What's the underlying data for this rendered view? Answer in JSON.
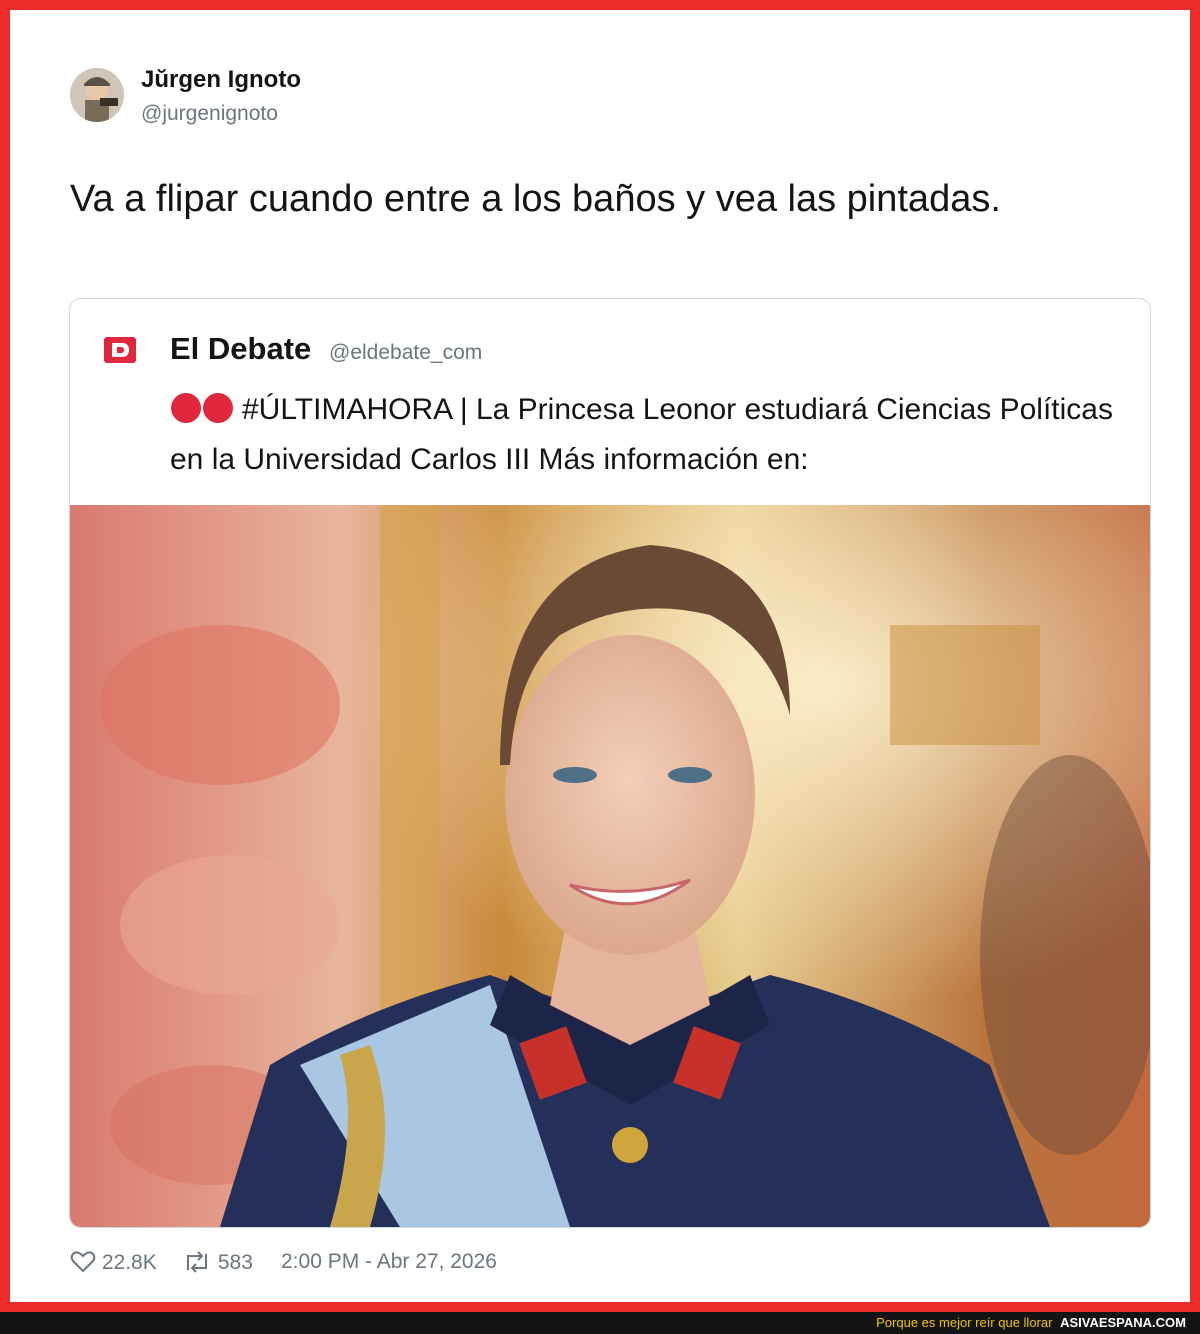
{
  "author": {
    "name": "Jŭrgen Ignoto",
    "handle": "@jurgenignoto"
  },
  "tweet": {
    "text": "Va a flipar cuando entre a los baños y vea las pintadas."
  },
  "quoted": {
    "logo_letter": "D",
    "name": "El Debate",
    "handle": "@eldebate_com",
    "text_main": "#ÚLTIMAHORA | La Princesa Leonor estudiará Ciencias Políticas en la Universidad Carlos III Más información en:",
    "media": "photo"
  },
  "stats": {
    "likes": "22.8K",
    "retweets": "583",
    "timestamp": "2:00 PM - Abr 27, 2026"
  },
  "footer": {
    "tagline": "Porque es mejor reír que llorar",
    "site": "ASIVAESPANA.COM"
  },
  "colors": {
    "frame": "#ee2a2a",
    "brand_red": "#e0273c",
    "footer_bg": "#141414",
    "footer_tag": "#f2c200",
    "muted": "#6b7680"
  },
  "icons": {
    "like": "heart-icon",
    "retweet": "retweet-icon",
    "logo": "el-debate-logo-icon",
    "badge": "red-circles-icon"
  }
}
